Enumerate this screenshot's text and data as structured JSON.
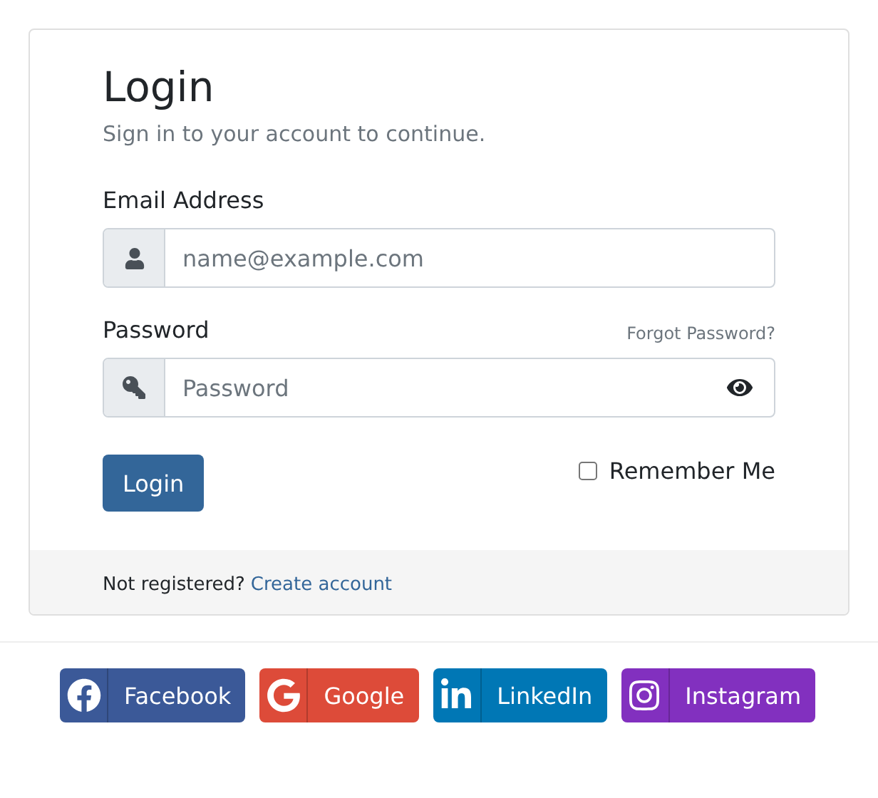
{
  "login_card": {
    "title": "Login",
    "subtitle": "Sign in to your account to continue.",
    "email": {
      "label": "Email Address",
      "placeholder": "name@example.com"
    },
    "password": {
      "label": "Password",
      "forgot_link": "Forgot Password?",
      "placeholder": "Password"
    },
    "submit_button": "Login",
    "remember_me": {
      "label": "Remember Me",
      "checked": false
    },
    "footer": {
      "text": "Not registered?",
      "link": "Create account"
    }
  },
  "social_buttons": [
    {
      "kind": "facebook",
      "label": "Facebook",
      "color": "#3b5998"
    },
    {
      "kind": "google",
      "label": "Google",
      "color": "#dd4b39"
    },
    {
      "kind": "linkedin",
      "label": "LinkedIn",
      "color": "#0077b5"
    },
    {
      "kind": "instagram",
      "label": "Instagram",
      "color": "#8230bf"
    }
  ]
}
